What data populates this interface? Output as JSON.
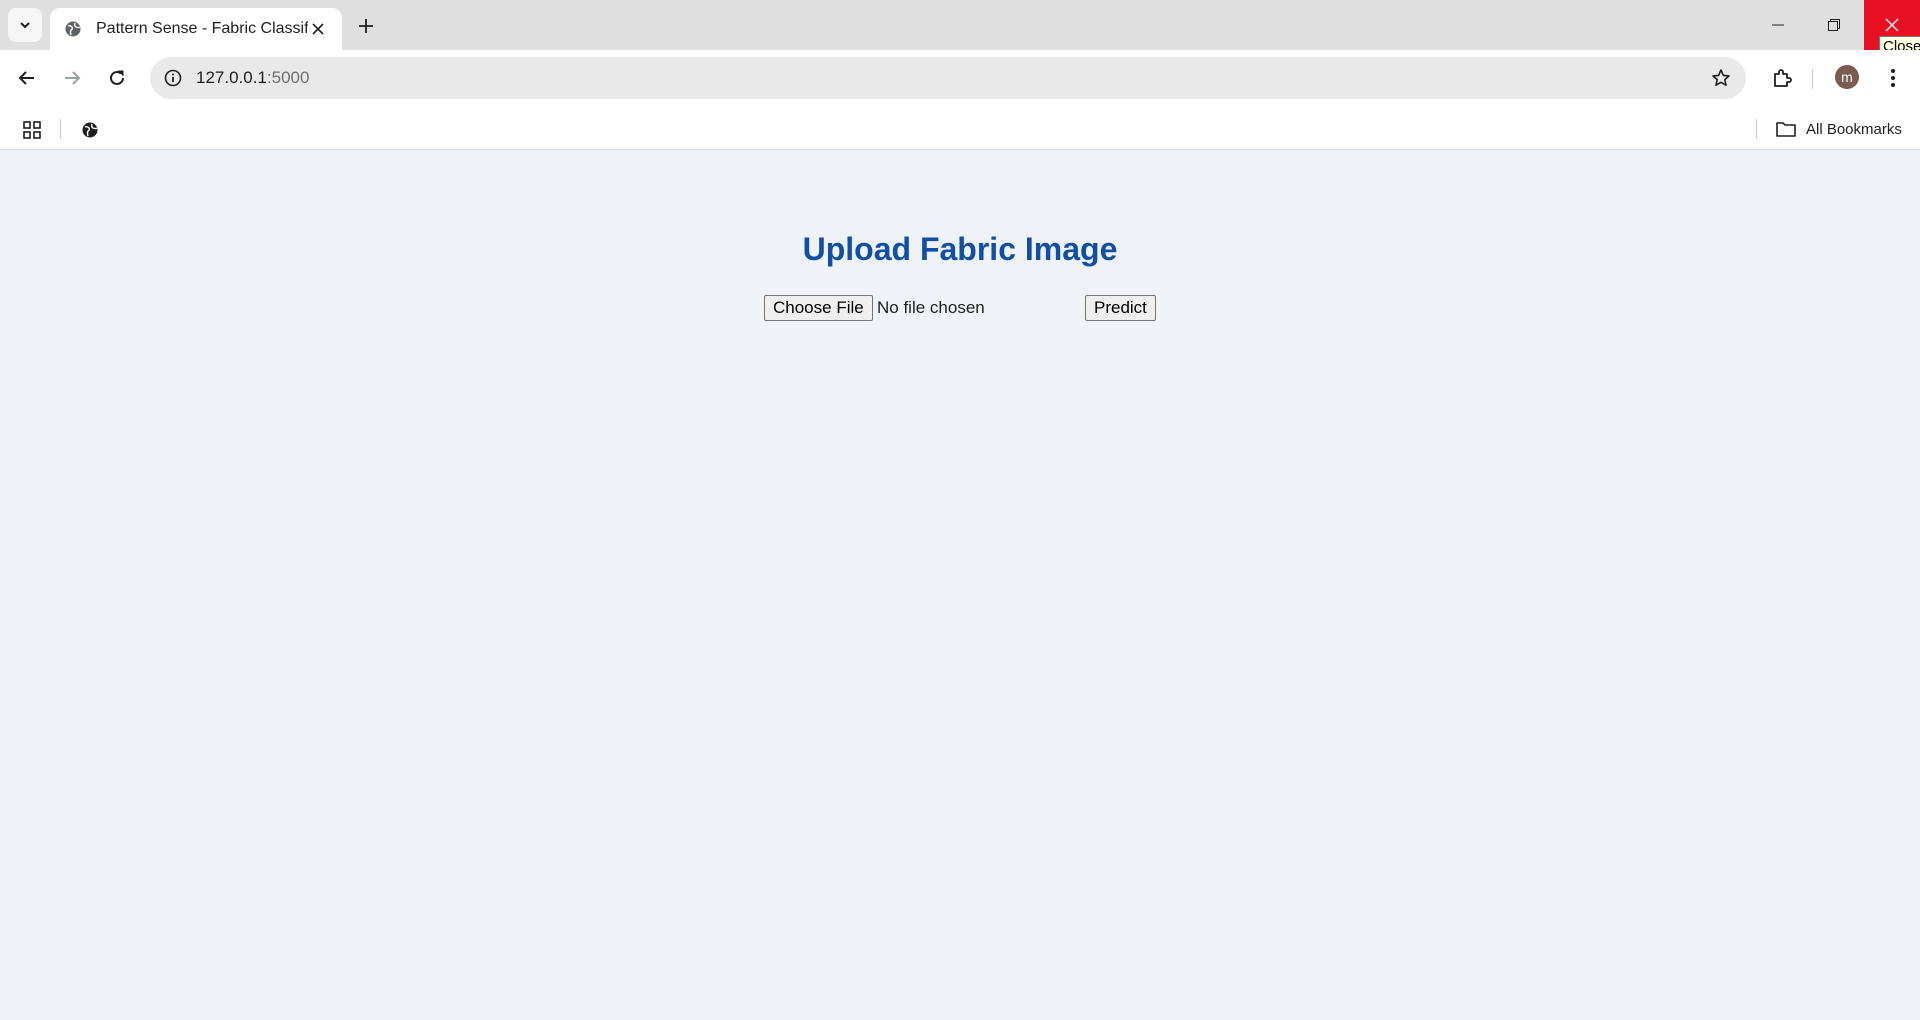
{
  "browser": {
    "tab": {
      "title": "Pattern Sense - Fabric Classifier"
    },
    "address": {
      "host": "127.0.0.1",
      "port": ":5000"
    },
    "tooltip": "Close",
    "profile_initial": "m",
    "bookmarks": {
      "all_label": "All Bookmarks"
    }
  },
  "page": {
    "heading": "Upload Fabric Image",
    "file_button_label": "Choose File",
    "file_status": "No file chosen",
    "predict_label": "Predict"
  },
  "colors": {
    "heading": "#0f4fa8",
    "page_background": "#eff3f8",
    "close_hover": "#e81123"
  }
}
